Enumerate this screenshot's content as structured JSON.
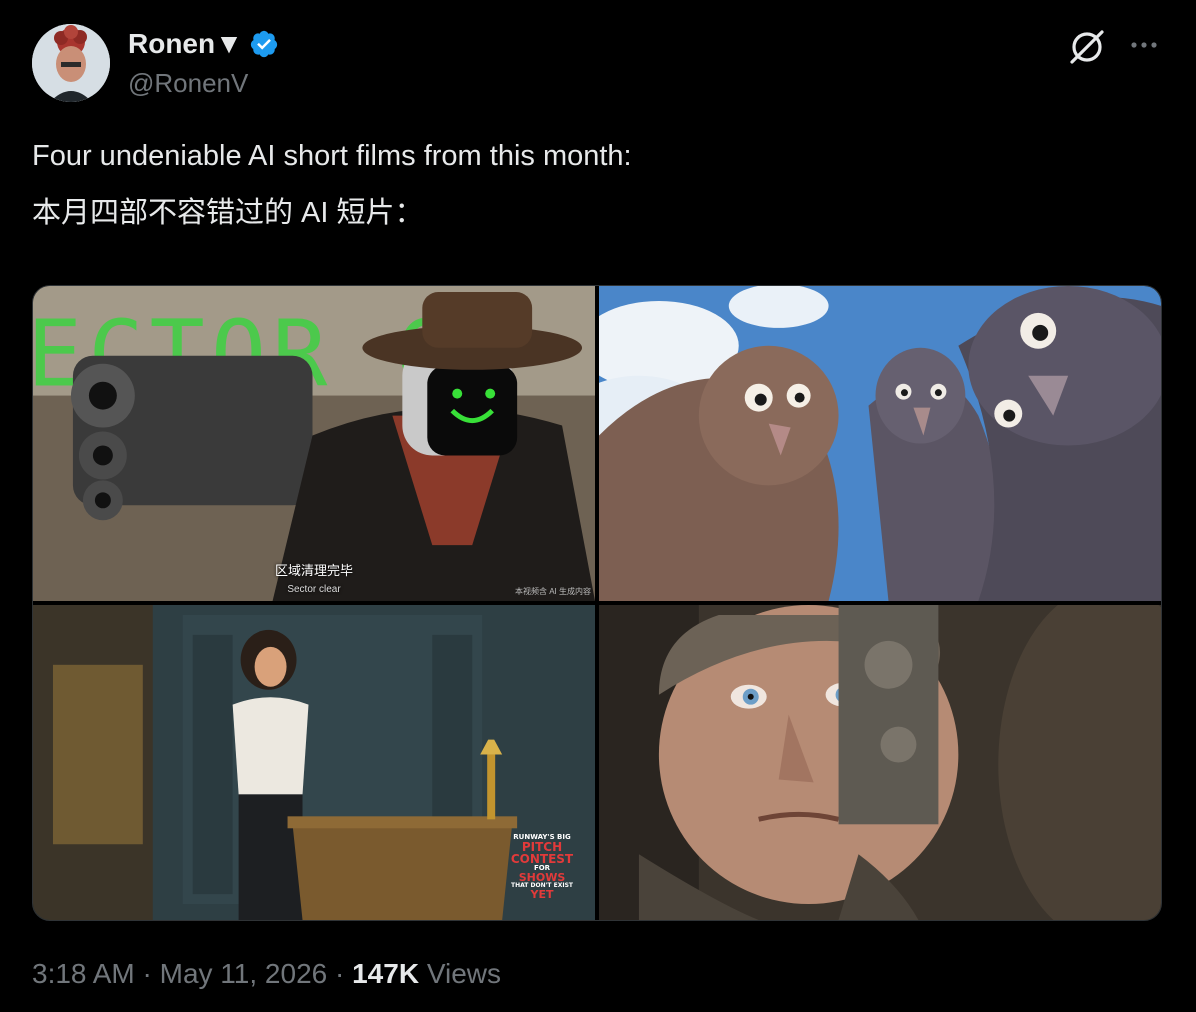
{
  "author": {
    "display_name": "Ronen▼",
    "handle": "@RonenV",
    "verified_color": "#1d9bf0"
  },
  "header_icons": [
    "grok-icon",
    "more-icon"
  ],
  "tweet": {
    "text_line_1": "Four undeniable AI short films from this month:",
    "text_line_2": "本月四部不容错过的 AI 短片："
  },
  "media": {
    "cell_1": {
      "sign_text": "ECTOR C",
      "caption_zh": "区域清理完毕",
      "caption_en": "Sector clear",
      "watermark": "本视频含 AI 生成内容"
    },
    "cell_2": {},
    "cell_3": {
      "poster_line_1": "RUNWAY'S BIG",
      "poster_line_2": "PITCH",
      "poster_line_3": "CONTEST",
      "poster_line_4": "FOR",
      "poster_line_5": "SHOWS",
      "poster_line_6": "THAT DON'T EXIST",
      "poster_line_7": "YET"
    },
    "cell_4": {}
  },
  "footer": {
    "time": "3:18 AM",
    "separator": "·",
    "date": "May 11, 2026",
    "views_count": "147K",
    "views_label": "Views"
  }
}
